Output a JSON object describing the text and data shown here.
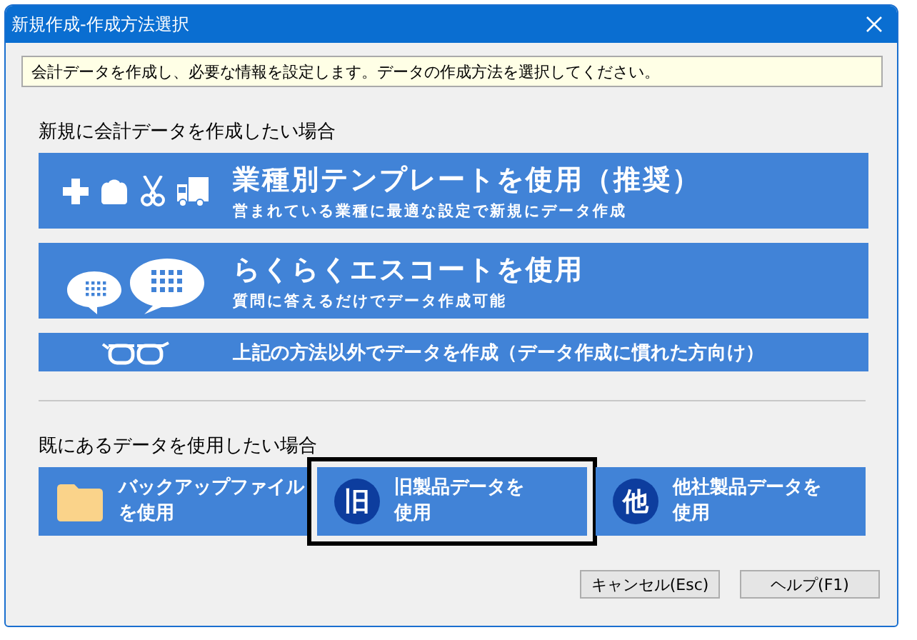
{
  "window": {
    "title": "新規作成-作成方法選択"
  },
  "info": "会計データを作成し、必要な情報を設定します。データの作成方法を選択してください。",
  "new_section": {
    "label": "新規に会計データを作成したい場合",
    "options": [
      {
        "kind": "template",
        "title": "業種別テンプレートを使用（推奨）",
        "subtitle": "営まれている業種に最適な設定で新規にデータ作成"
      },
      {
        "kind": "escort",
        "title": "らくらくエスコートを使用",
        "subtitle": "質問に答えるだけでデータ作成可能"
      },
      {
        "kind": "manual",
        "title": "上記の方法以外でデータを作成（データ作成に慣れた方向け）"
      }
    ]
  },
  "existing_section": {
    "label": "既にあるデータを使用したい場合",
    "options": [
      {
        "kind": "backup",
        "label": "バックアップファイルを使用",
        "selected": false
      },
      {
        "kind": "old",
        "badge": "旧",
        "label": "旧製品データを使用",
        "selected": true
      },
      {
        "kind": "other",
        "badge": "他",
        "label": "他社製品データを使用",
        "selected": false
      }
    ]
  },
  "buttons": [
    "キャンセル(Esc)",
    "ヘルプ(F1)"
  ]
}
